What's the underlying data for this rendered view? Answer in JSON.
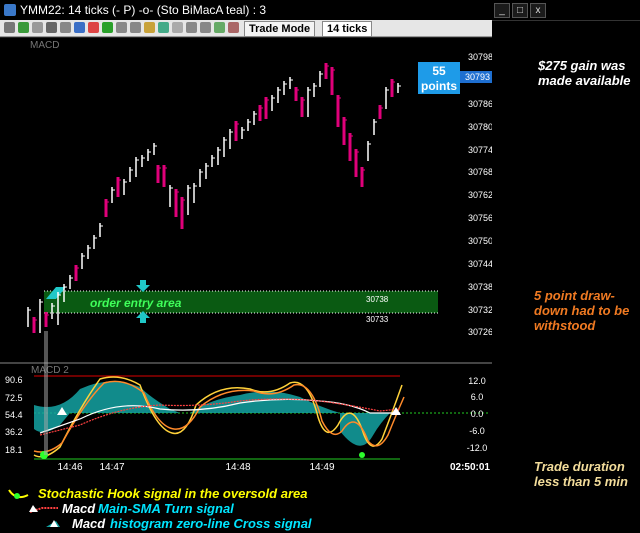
{
  "window": {
    "title": "YMM22: 14 ticks (-  P) -o- (Sto BiMacA teal) : 3"
  },
  "toolbar": {
    "trade_mode_label": "Trade Mode",
    "tick_setting": "14 ticks"
  },
  "price_panel": {
    "indicator_label": "MACD",
    "price_axis": [
      "30798",
      "30786",
      "30780",
      "30774",
      "30768",
      "30762",
      "30756",
      "30750",
      "30744",
      "30738",
      "30732",
      "30726"
    ],
    "current_price": "30793",
    "entry_zone_label": "order entry area",
    "entry_high": "30738",
    "entry_low": "30733",
    "points_callout": "55 points"
  },
  "macd_panel": {
    "label": "MACD 2",
    "left_axis": [
      "90.6",
      "72.5",
      "54.4",
      "36.2",
      "18.1"
    ],
    "right_axis": [
      "12.0",
      "6.0",
      "0.0",
      "-6.0",
      "-12.0"
    ]
  },
  "time_axis": [
    "14:46",
    "14:47",
    "14:48",
    "14:49"
  ],
  "clock": "02:50:01",
  "annotations": {
    "gain": "$275 gain was made available",
    "drawdown": "5 point draw-down had to be withstood",
    "duration": "Trade duration less than 5 min"
  },
  "legend": [
    {
      "text": "Stochastic Hook signal in the oversold area",
      "color": "#ffff00"
    },
    {
      "prefix": "Macd",
      "text": "Main-SMA Turn signal",
      "color": "#00e5ff"
    },
    {
      "prefix": "Macd",
      "text": "histogram zero-line Cross signal",
      "color": "#00e5ff"
    }
  ],
  "colors": {
    "bull": "#ffffff",
    "bear": "#e0007a",
    "entry_zone": "#0a5a12",
    "callout": "#1e9be8",
    "annotation_orange": "#f07a22",
    "annotation_yellow": "#f2dc9a",
    "teal": "#14a3a3"
  }
}
